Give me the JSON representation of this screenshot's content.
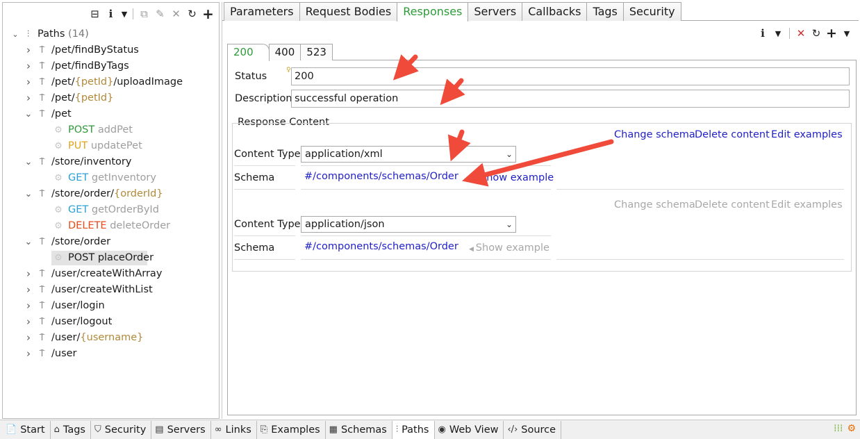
{
  "left_toolbar": {
    "icons": [
      "collapse-all-icon",
      "info-icon",
      "dropdown-icon",
      "copy-icon",
      "edit-icon",
      "delete-icon",
      "refresh-icon",
      "add-icon"
    ]
  },
  "tree": {
    "root_label": "Paths",
    "root_count": "(14)",
    "rows": [
      {
        "type": "path",
        "label": "/pet/findByStatus",
        "expanded": false
      },
      {
        "type": "path",
        "label": "/pet/findByTags",
        "expanded": false
      },
      {
        "type": "path",
        "pre": "/pet/",
        "param": "{petId}",
        "post": "/uploadImage",
        "expanded": false
      },
      {
        "type": "path",
        "pre": "/pet/",
        "param": "{petId}",
        "post": "",
        "expanded": false
      },
      {
        "type": "path",
        "label": "/pet",
        "expanded": true
      },
      {
        "type": "op",
        "verb": "POST",
        "verb_class": "verb-post",
        "name": "addPet"
      },
      {
        "type": "op",
        "verb": "PUT",
        "verb_class": "verb-put",
        "name": "updatePet"
      },
      {
        "type": "path",
        "label": "/store/inventory",
        "expanded": true
      },
      {
        "type": "op",
        "verb": "GET",
        "verb_class": "verb-get",
        "name": "getInventory"
      },
      {
        "type": "path",
        "pre": "/store/order/",
        "param": "{orderId}",
        "post": "",
        "expanded": true
      },
      {
        "type": "op",
        "verb": "GET",
        "verb_class": "verb-get",
        "name": "getOrderById"
      },
      {
        "type": "op",
        "verb": "DELETE",
        "verb_class": "verb-delete",
        "name": "deleteOrder"
      },
      {
        "type": "path",
        "label": "/store/order",
        "expanded": true
      },
      {
        "type": "op",
        "verb": "POST",
        "verb_class": "verb-post",
        "name": "placeOrder",
        "selected": true
      },
      {
        "type": "path",
        "label": "/user/createWithArray",
        "expanded": false
      },
      {
        "type": "path",
        "label": "/user/createWithList",
        "expanded": false
      },
      {
        "type": "path",
        "label": "/user/login",
        "expanded": false
      },
      {
        "type": "path",
        "label": "/user/logout",
        "expanded": false
      },
      {
        "type": "path",
        "pre": "/user/",
        "param": "{username}",
        "post": "",
        "expanded": false
      },
      {
        "type": "path",
        "label": "/user",
        "expanded": false
      }
    ]
  },
  "top_tabs": [
    "Parameters",
    "Request Bodies",
    "Responses",
    "Servers",
    "Callbacks",
    "Tags",
    "Security"
  ],
  "active_top_tab": "Responses",
  "response_tabs": [
    "200",
    "400",
    "523"
  ],
  "active_response_tab": "200",
  "form": {
    "status_label": "Status",
    "status_value": "200",
    "description_label": "Description",
    "description_value": "successful operation"
  },
  "response_content": {
    "title": "Response Content",
    "content_type_label": "Content Type",
    "schema_label": "Schema",
    "actions": {
      "change": "Change schema",
      "delete": "Delete content",
      "edit": "Edit examples"
    },
    "show_example": "Show example",
    "entries": [
      {
        "content_type": "application/xml",
        "schema": "#/components/schemas/Order"
      },
      {
        "content_type": "application/json",
        "schema": "#/components/schemas/Order"
      }
    ]
  },
  "bottom_tabs": [
    {
      "label": "Start",
      "icon": "start-icon",
      "glyph": "📄"
    },
    {
      "label": "Tags",
      "icon": "tag-icon",
      "glyph": "⌂"
    },
    {
      "label": "Security",
      "icon": "shield-icon",
      "glyph": "⛉"
    },
    {
      "label": "Servers",
      "icon": "server-icon",
      "glyph": "▤"
    },
    {
      "label": "Links",
      "icon": "link-icon",
      "glyph": "∞"
    },
    {
      "label": "Examples",
      "icon": "examples-icon",
      "glyph": "⎘"
    },
    {
      "label": "Schemas",
      "icon": "schemas-icon",
      "glyph": "▦"
    },
    {
      "label": "Paths",
      "icon": "paths-icon",
      "glyph": "⫶"
    },
    {
      "label": "Web View",
      "icon": "globe-icon",
      "glyph": "◉"
    },
    {
      "label": "Source",
      "icon": "source-icon",
      "glyph": "‹/›"
    }
  ],
  "active_bottom_tab": "Paths",
  "colors": {
    "accent_green": "#2e9a39",
    "link_blue": "#1f1fc8",
    "arrow_red": "#f04a3a",
    "param_gold": "#b08a3a"
  }
}
